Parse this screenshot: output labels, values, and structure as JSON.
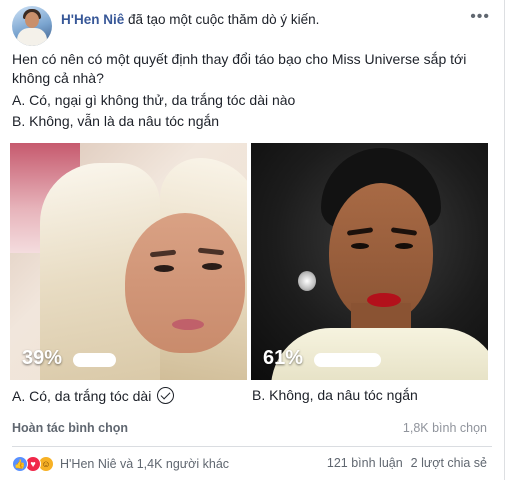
{
  "post": {
    "author": "H'Hen Niê",
    "action": "đã tạo một cuộc thăm dò ý kiến.",
    "question": "Hen có nên có một quyết định thay đổi táo bạo cho Miss Universe sắp tới không cả nhà?",
    "option_a_text": "A. Có, ngại gì không thử, da trắng tóc dài nào",
    "option_b_text": "B. Không, vẫn là da nâu tóc ngắn"
  },
  "poll": {
    "choices": [
      {
        "percent_label": "39%",
        "percent": 39,
        "label": "A. Có, da trắng tóc dài",
        "selected": true
      },
      {
        "percent_label": "61%",
        "percent": 61,
        "label": "B. Không, da nâu tóc ngắn",
        "selected": false
      }
    ],
    "undo_label": "Hoàn tác bình chọn",
    "vote_count": "1,8K bình chọn"
  },
  "footer": {
    "reactions_text": "H'Hen Niê và 1,4K người khác",
    "comments": "121 bình luận",
    "shares": "2 lượt chia sẻ"
  },
  "icons": {
    "more": "more-options-icon",
    "check": "check-circle-icon",
    "like": "like-reaction-icon",
    "love": "love-reaction-icon",
    "haha": "haha-reaction-icon"
  },
  "colors": {
    "author_link": "#385898",
    "like_blue": "#5890ff",
    "love_red": "#f0284a",
    "haha_yellow": "#f7b125"
  }
}
